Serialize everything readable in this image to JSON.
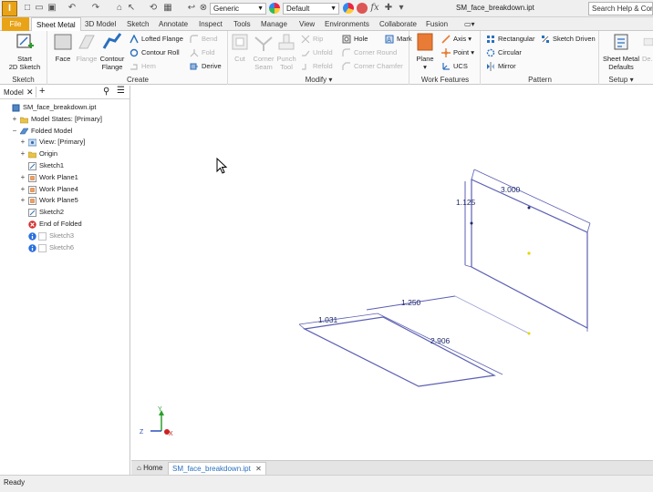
{
  "app": {
    "logo_letter": "I",
    "doc_title": "SM_face_breakdown.ipt",
    "help_search_placeholder": "Search Help & Commands..."
  },
  "quick_access": {
    "material_value": "Generic",
    "appearance_value": "Default",
    "formula_symbol": "fx"
  },
  "tabs": [
    {
      "label": "File"
    },
    {
      "label": "Sheet Metal"
    },
    {
      "label": "3D Model"
    },
    {
      "label": "Sketch"
    },
    {
      "label": "Annotate"
    },
    {
      "label": "Inspect"
    },
    {
      "label": "Tools"
    },
    {
      "label": "Manage"
    },
    {
      "label": "View"
    },
    {
      "label": "Environments"
    },
    {
      "label": "Collaborate"
    },
    {
      "label": "Fusion"
    }
  ],
  "ribbon": {
    "sketch": {
      "title": "Sketch",
      "start_label_1": "Start",
      "start_label_2": "2D Sketch"
    },
    "create": {
      "title": "Create",
      "face": "Face",
      "flange": "Flange",
      "contour_flange_1": "Contour",
      "contour_flange_2": "Flange",
      "lofted_flange": "Lofted Flange",
      "contour_roll": "Contour Roll",
      "hem": "Hem",
      "bend": "Bend",
      "fold": "Fold",
      "derive": "Derive"
    },
    "modify": {
      "title": "Modify",
      "cut": "Cut",
      "corner_seam_1": "Corner",
      "corner_seam_2": "Seam",
      "punch_tool_1": "Punch",
      "punch_tool_2": "Tool",
      "rip": "Rip",
      "unfold": "Unfold",
      "refold": "Refold",
      "hole": "Hole",
      "corner_round": "Corner Round",
      "corner_chamfer": "Corner Chamfer",
      "mark": "Mark"
    },
    "work_features": {
      "title": "Work Features",
      "plane": "Plane",
      "axis": "Axis",
      "point": "Point",
      "ucs": "UCS"
    },
    "pattern": {
      "title": "Pattern",
      "rectangular": "Rectangular",
      "circular": "Circular",
      "mirror": "Mirror",
      "sketch_driven": "Sketch Driven"
    },
    "setup": {
      "title": "Setup",
      "defaults_1": "Sheet Metal",
      "defaults_2": "Defaults",
      "extra": "De..."
    }
  },
  "browser": {
    "tab_label": "Model",
    "tree": [
      {
        "label": "SM_face_breakdown.ipt",
        "icon": "part-icon",
        "indent": 0,
        "exp": "",
        "dim": false
      },
      {
        "label": "Model States: [Primary]",
        "icon": "folder-icon",
        "indent": 1,
        "exp": "+",
        "dim": false
      },
      {
        "label": "Folded Model",
        "icon": "sheetmetal-icon",
        "indent": 1,
        "exp": "−",
        "dim": false
      },
      {
        "label": "View: [Primary]",
        "icon": "view-icon",
        "indent": 2,
        "exp": "+",
        "dim": false
      },
      {
        "label": "Origin",
        "icon": "folder-icon",
        "indent": 2,
        "exp": "+",
        "dim": false
      },
      {
        "label": "Sketch1",
        "icon": "sketch-icon",
        "indent": 2,
        "exp": "",
        "dim": false
      },
      {
        "label": "Work Plane1",
        "icon": "workplane-icon",
        "indent": 2,
        "exp": "+",
        "dim": false
      },
      {
        "label": "Work Plane4",
        "icon": "workplane-icon",
        "indent": 2,
        "exp": "+",
        "dim": false
      },
      {
        "label": "Work Plane5",
        "icon": "workplane-icon",
        "indent": 2,
        "exp": "+",
        "dim": false
      },
      {
        "label": "Sketch2",
        "icon": "sketch-icon",
        "indent": 2,
        "exp": "",
        "dim": false
      },
      {
        "label": "End of Folded",
        "icon": "end-of-part-icon",
        "indent": 2,
        "exp": "",
        "dim": false
      },
      {
        "label": "Sketch3",
        "icon": "info-icon",
        "indent": 2,
        "exp": "",
        "dim": true
      },
      {
        "label": "Sketch6",
        "icon": "info-icon",
        "indent": 2,
        "exp": "",
        "dim": true
      }
    ]
  },
  "canvas": {
    "dimensions": {
      "d1": "1.125",
      "d2": "3.000",
      "d3": "1.250",
      "d4": "1.031",
      "d5": "2.906"
    },
    "triad": {
      "x": "X",
      "y": "Y",
      "z": "Z"
    }
  },
  "doc_tabs": {
    "home": "Home",
    "active": "SM_face_breakdown.ipt",
    "close_symbol": "✕"
  },
  "status": {
    "text": "Ready"
  },
  "colors": {
    "inventor_orange": "#e8a317",
    "sketch_line": "#5b5fb3",
    "dimension_text": "#1f2a6b",
    "point_yellow": "#e6d400"
  }
}
